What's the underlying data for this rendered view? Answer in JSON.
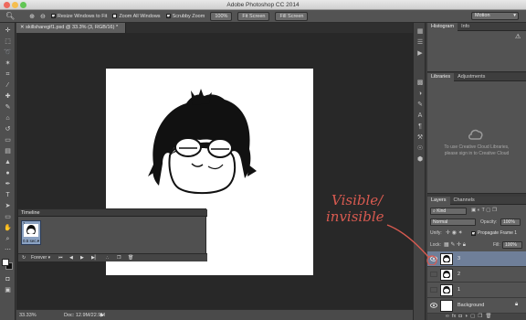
{
  "window": {
    "title": "Adobe Photoshop CC 2014"
  },
  "options_bar": {
    "resize_windows_label": "Resize Windows to Fit",
    "zoom_all_label": "Zoom All Windows",
    "scrubby_zoom_label": "Scrubby Zoom",
    "zoom_level": "100%",
    "fit_screen_label": "Fit Screen",
    "fill_screen_label": "Fill Screen",
    "workspace": "Motion"
  },
  "document": {
    "tab_label": "skillsharegif1.psd @ 33.3% (3, RGB/16) *"
  },
  "status": {
    "zoom": "33.33%",
    "doc_size": "Doc: 12.9M/22.9M"
  },
  "timeline": {
    "title": "Timeline",
    "frame_number": "1",
    "frame_delay": "0.5 sec.",
    "loop": "Forever"
  },
  "histogram_panel": {
    "tabs": [
      "Histogram",
      "Info"
    ]
  },
  "libraries_panel": {
    "tabs": [
      "Libraries",
      "Adjustments"
    ],
    "message_line1": "To use Creative Cloud Libraries,",
    "message_line2": "please sign in to Creative Cloud"
  },
  "layers_panel": {
    "tabs": [
      "Layers",
      "Channels"
    ],
    "kind_filter": "Kind",
    "blend_mode": "Normal",
    "opacity_label": "Opacity:",
    "opacity_value": "100%",
    "unify_label": "Unify:",
    "propagate_label": "Propagate Frame 1",
    "lock_label": "Lock:",
    "fill_label": "Fill:",
    "fill_value": "100%",
    "layers": [
      {
        "name": "3",
        "selected": true
      },
      {
        "name": "2",
        "selected": false
      },
      {
        "name": "1",
        "selected": false
      },
      {
        "name": "Background",
        "selected": false
      }
    ]
  },
  "annotation": {
    "line1": "Visible/",
    "line2": "invisible"
  },
  "colors": {
    "accent_annotation": "#d85a50",
    "selected_layer": "#6f7f99"
  }
}
